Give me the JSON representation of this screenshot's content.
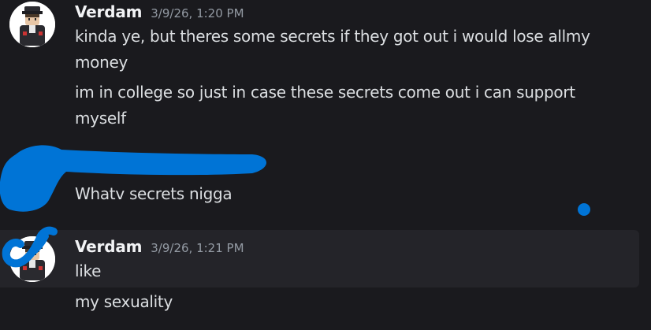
{
  "colors": {
    "background": "#1a1a1e",
    "hover_background": "#242429",
    "username": "#f2f3f5",
    "timestamp": "#949ba4",
    "message_text": "#dbdee1",
    "scribble_blue": "#0074d6"
  },
  "messages": [
    {
      "author": "Verdam",
      "timestamp": "3/9/26, 1:20 PM",
      "lines": [
        "kinda ye, but theres some secrets if they got out i would lose allmy money",
        "im in college so just in case these secrets come out i can support myself"
      ]
    },
    {
      "author": "",
      "timestamp": "",
      "lines": [
        "Whatv secrets nigga"
      ]
    },
    {
      "author": "Verdam",
      "timestamp": "3/9/26, 1:21 PM",
      "lines": [
        "like",
        "my sexuality"
      ]
    }
  ],
  "icons": {
    "avatar_1": "avatar-character-icon",
    "avatar_2": "avatar-character-icon"
  }
}
